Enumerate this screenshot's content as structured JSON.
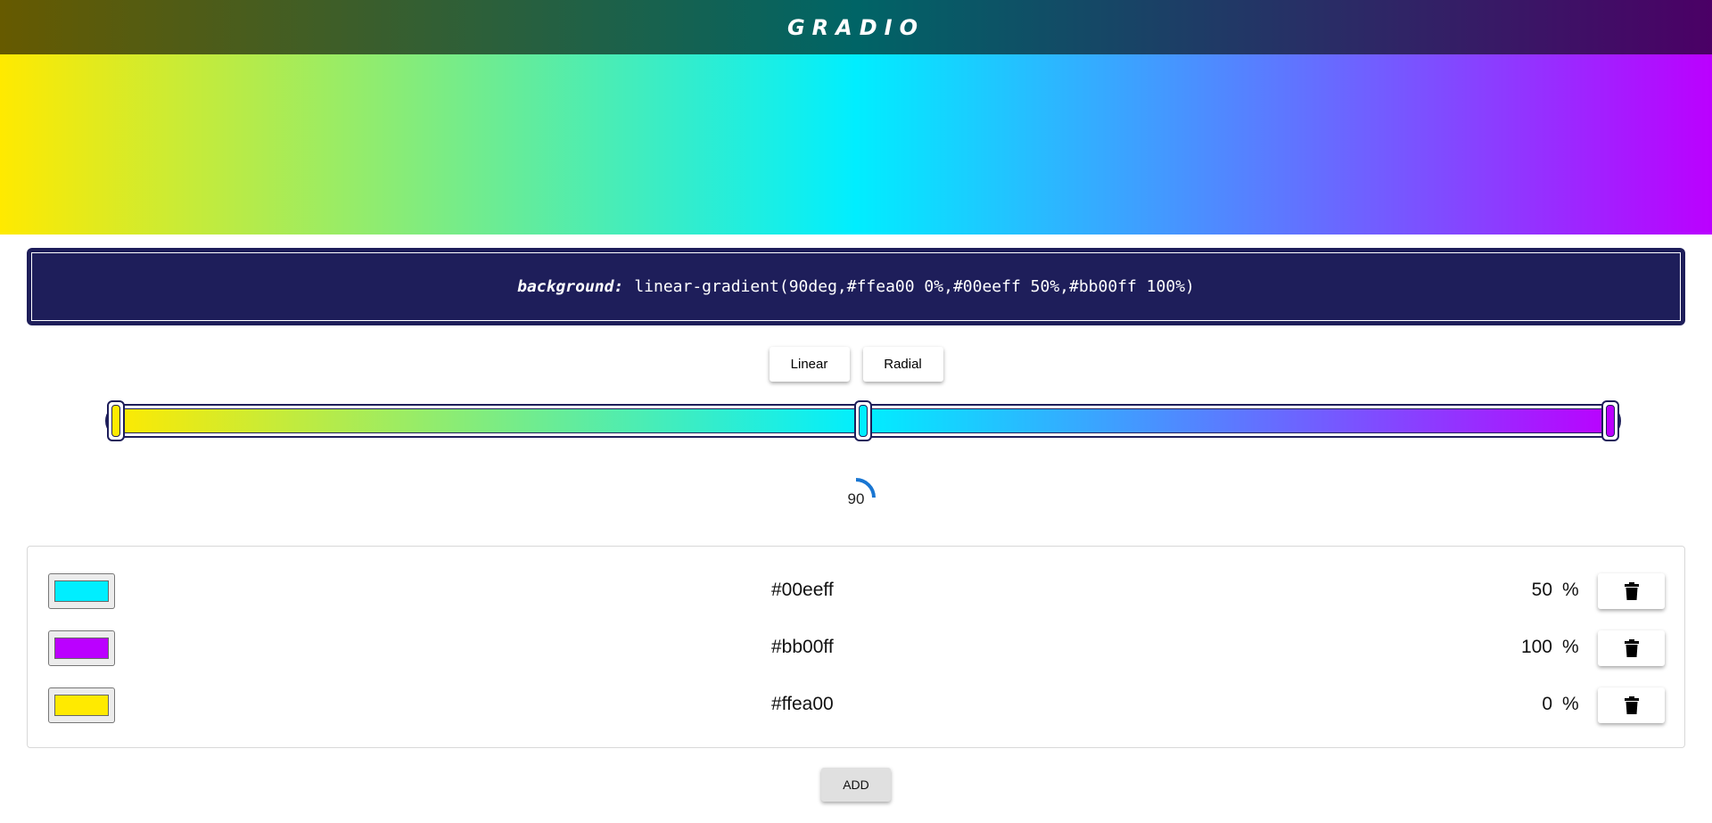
{
  "header": {
    "brand": "GRADIO",
    "colors": [
      "#665a00",
      "#006466",
      "#4b0066"
    ]
  },
  "gradient": {
    "type": "linear",
    "angle": 90,
    "angle_label": "90",
    "stops": [
      {
        "color": "#ffea00",
        "position": 0
      },
      {
        "color": "#00eeff",
        "position": 50
      },
      {
        "color": "#bb00ff",
        "position": 100
      }
    ]
  },
  "css_output": {
    "property": "background:",
    "value": "linear-gradient(90deg,#ffea00 0%,#00eeff 50%,#bb00ff 100%)"
  },
  "type_buttons": {
    "linear_label": "Linear",
    "radial_label": "Radial"
  },
  "stop_rows": [
    {
      "hex": "#00eeff",
      "position": "50",
      "unit": "%",
      "delete_icon": "trash-icon"
    },
    {
      "hex": "#bb00ff",
      "position": "100",
      "unit": "%",
      "delete_icon": "trash-icon"
    },
    {
      "hex": "#ffea00",
      "position": "0",
      "unit": "%",
      "delete_icon": "trash-icon"
    }
  ],
  "add_button": {
    "label": "ADD"
  },
  "theme": {
    "accent_dark": "#1e1e5a",
    "dial_color": "#1976d2"
  }
}
